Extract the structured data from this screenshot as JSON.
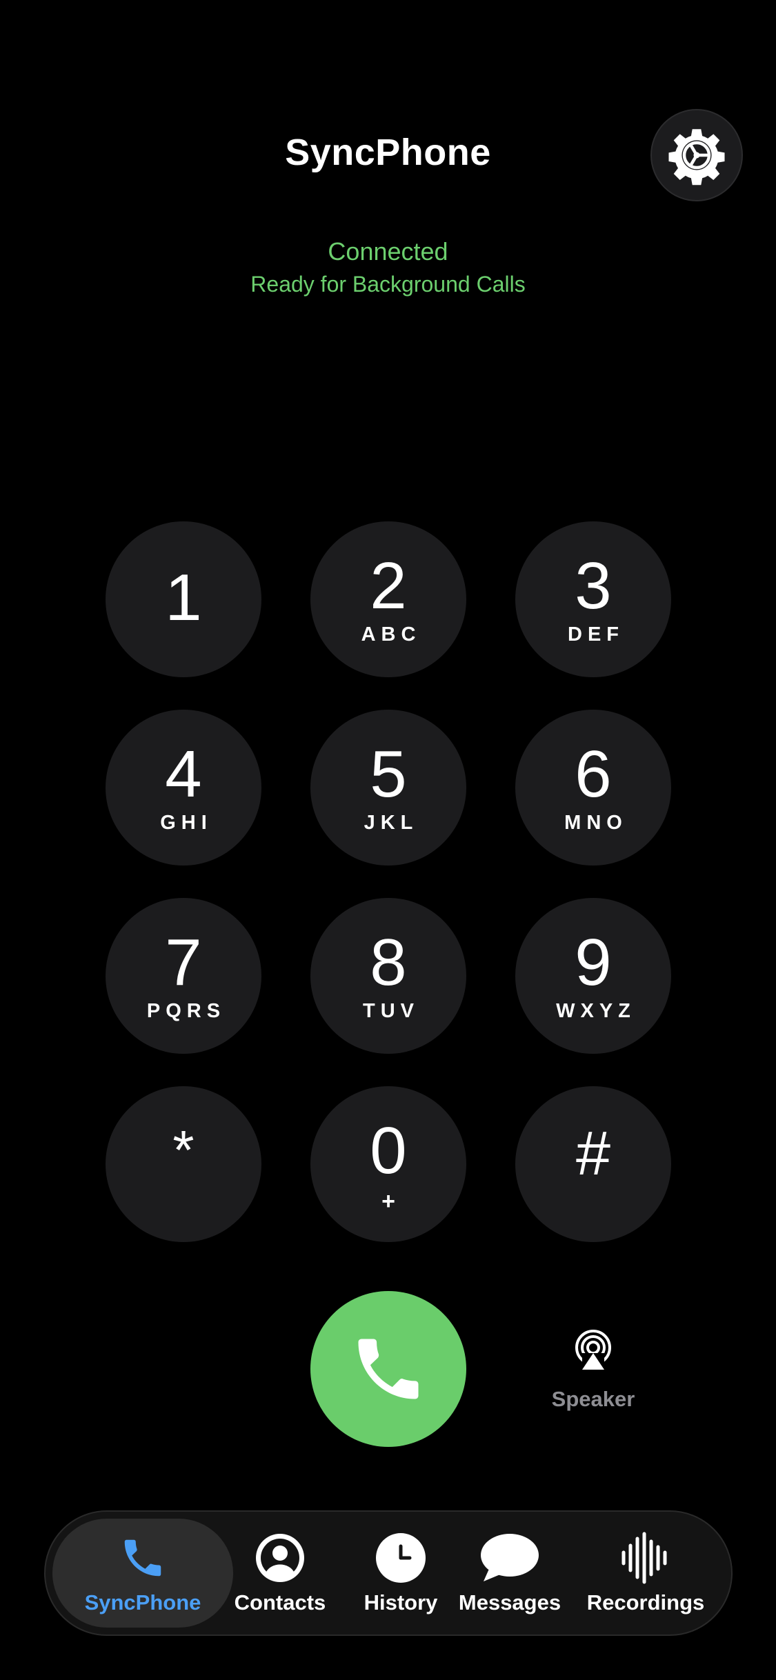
{
  "header": {
    "title": "SyncPhone",
    "settings_icon": "gear-icon"
  },
  "status": {
    "primary": "Connected",
    "secondary": "Ready for Background Calls",
    "color": "#6ccf6e"
  },
  "keypad": {
    "keys": [
      {
        "digit": "1",
        "letters": ""
      },
      {
        "digit": "2",
        "letters": "ABC"
      },
      {
        "digit": "3",
        "letters": "DEF"
      },
      {
        "digit": "4",
        "letters": "GHI"
      },
      {
        "digit": "5",
        "letters": "JKL"
      },
      {
        "digit": "6",
        "letters": "MNO"
      },
      {
        "digit": "7",
        "letters": "PQRS"
      },
      {
        "digit": "8",
        "letters": "TUV"
      },
      {
        "digit": "9",
        "letters": "WXYZ"
      },
      {
        "digit": "*",
        "letters": ""
      },
      {
        "digit": "0",
        "letters": "+"
      },
      {
        "digit": "#",
        "letters": ""
      }
    ]
  },
  "actions": {
    "call_icon": "phone-icon",
    "call_color": "#6acd6b",
    "speaker_label": "Speaker",
    "speaker_icon": "airplay-audio-icon"
  },
  "tab_bar": {
    "active_color": "#4b9ff5",
    "tabs": [
      {
        "label": "SyncPhone",
        "icon": "phone-icon",
        "active": true
      },
      {
        "label": "Contacts",
        "icon": "person-circle-icon",
        "active": false
      },
      {
        "label": "History",
        "icon": "clock-icon",
        "active": false
      },
      {
        "label": "Messages",
        "icon": "message-bubble-icon",
        "active": false
      },
      {
        "label": "Recordings",
        "icon": "waveform-icon",
        "active": false
      }
    ]
  }
}
